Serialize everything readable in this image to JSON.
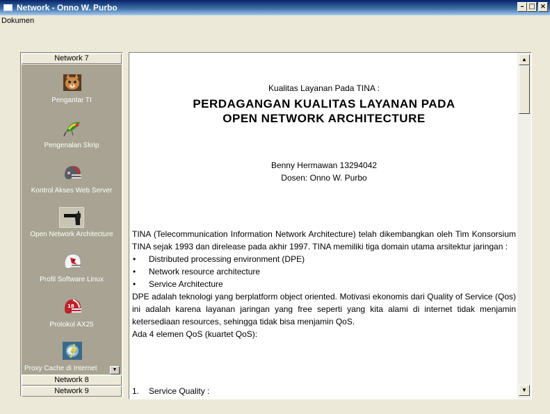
{
  "window": {
    "title": "Network - Onno W. Purbo",
    "buttons": {
      "minimize": "–",
      "maximize": "□",
      "close": "×"
    }
  },
  "menu": {
    "items": [
      "Dokumen"
    ]
  },
  "sidebar": {
    "groups": [
      "Network 7",
      "Network 8",
      "Network 9"
    ],
    "items": [
      {
        "label": "Pengantar TI",
        "icon": "cat-icon"
      },
      {
        "label": "Pengenalan Skrip",
        "icon": "lure-icon"
      },
      {
        "label": "Kontrol Akses Web Server",
        "icon": "helmet-icon"
      },
      {
        "label": "Open Network Architecture",
        "icon": "pistol-icon"
      },
      {
        "label": "Profil Software Linux",
        "icon": "cardinal-helmet-icon"
      },
      {
        "label": "Protokol AX25",
        "icon": "red-helmet-icon"
      },
      {
        "label": "Proxy Cache di Internet",
        "icon": "cyclone-icon"
      }
    ],
    "scroll_down": "▼"
  },
  "document": {
    "subtitle": "Kualitas Layanan Pada TINA :",
    "title_line1": "PERDAGANGAN KUALITAS LAYANAN PADA",
    "title_line2": "OPEN NETWORK ARCHITECTURE",
    "author": "Benny Hermawan 13294042",
    "supervisor": "Dosen: Onno W. Purbo",
    "para1": "TINA (Telecommunication Information Network Architecture)  telah dikembangkan oleh Tim Konsorsium TINA sejak 1993 dan direlease pada akhir 1997. TINA memiliki tiga domain utama arsitektur jaringan :",
    "bullets": [
      "Distributed processing environment (DPE)",
      "Network resource architecture",
      "Service Architecture"
    ],
    "para2": "DPE adalah teknologi yang berplatform object oriented. Motivasi ekonomis dari  Quality of  Service (Qos) ini adalah karena layanan jaringan yang free seperti yang kita alami di internet tidak menjamin ketersediaan resources, sehingga tidak bisa menjamin QoS.",
    "para3": "Ada 4 elemen QoS (kuartet QoS):",
    "numbered_1_num": "1.",
    "numbered_1_text": "Service Quality :"
  },
  "scrollbar": {
    "up": "▲",
    "down": "▼"
  },
  "colors": {
    "titlebar_start": "#0a246a",
    "titlebar_end": "#a6caf0",
    "panel_bg": "#a8a392",
    "window_bg": "#ece9d8"
  }
}
